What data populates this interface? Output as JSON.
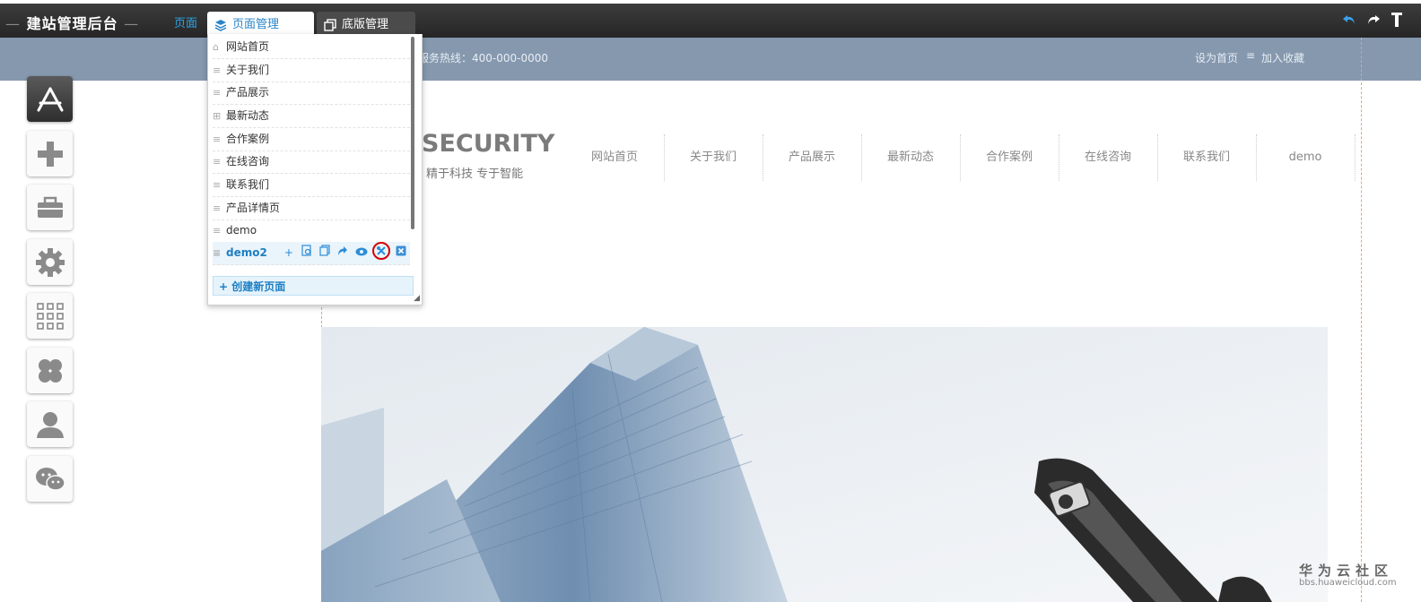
{
  "topbar": {
    "brand": "建站管理后台",
    "brand_dash": "—",
    "page_link": "页面",
    "tabs": [
      {
        "label": "页面管理",
        "icon": "layers-icon",
        "active": true
      },
      {
        "label": "底版管理",
        "icon": "copy-icon",
        "active": false
      }
    ],
    "right_icons": [
      "undo-icon",
      "redo-icon",
      "pin-icon"
    ],
    "colors": {
      "accent": "#2aa6e9",
      "background": "#2f2f2f"
    }
  },
  "site_header": {
    "hotline": "服务热线：400-000-0000",
    "set_home": "设为首页",
    "separator": "≡",
    "add_favorite": "加入收藏",
    "background": "#8598ae"
  },
  "left_toolbar": [
    {
      "name": "app-store-icon"
    },
    {
      "name": "add-icon"
    },
    {
      "name": "toolbox-icon"
    },
    {
      "name": "settings-gear-icon"
    },
    {
      "name": "grid-apps-icon"
    },
    {
      "name": "clover-icon"
    },
    {
      "name": "user-icon"
    },
    {
      "name": "wechat-icon"
    }
  ],
  "page_panel": {
    "pages": [
      {
        "label": "网站首页",
        "lead": "⌂"
      },
      {
        "label": "关于我们",
        "lead": "≡"
      },
      {
        "label": "产品展示",
        "lead": "≡"
      },
      {
        "label": "最新动态",
        "lead": "⊞"
      },
      {
        "label": "合作案例",
        "lead": "≡"
      },
      {
        "label": "在线咨询",
        "lead": "≡"
      },
      {
        "label": "联系我们",
        "lead": "≡"
      },
      {
        "label": "产品详情页",
        "lead": "≡"
      },
      {
        "label": "demo",
        "lead": "≡"
      },
      {
        "label": "demo2",
        "lead": "≡",
        "selected": true
      }
    ],
    "row_actions": [
      "add-icon",
      "page-settings-icon",
      "copy-icon",
      "share-icon",
      "view-icon",
      "tools-icon",
      "delete-icon"
    ],
    "create_label": "创建新页面",
    "create_icon": "+"
  },
  "site": {
    "logo": "SECURITY",
    "slogan": "精于科技  专于智能",
    "nav": [
      "网站首页",
      "关于我们",
      "产品展示",
      "最新动态",
      "合作案例",
      "在线咨询",
      "联系我们",
      "demo"
    ]
  },
  "watermark": {
    "text": "华为云社区",
    "url": "bbs.huaweicloud.com"
  }
}
